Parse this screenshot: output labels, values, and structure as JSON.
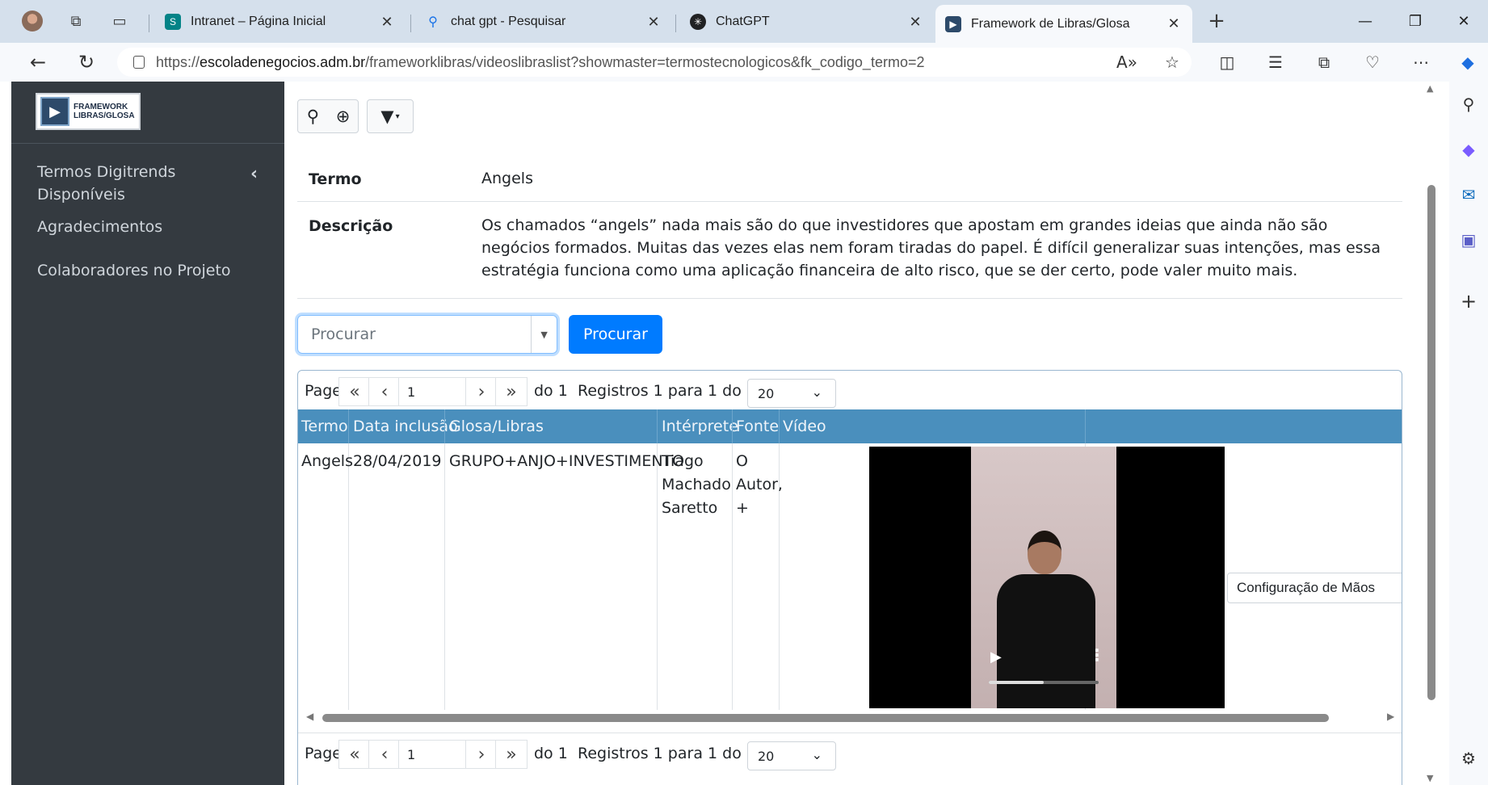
{
  "browser": {
    "tabs": [
      {
        "label": "Intranet – Página Inicial",
        "icon": "sharepoint-icon",
        "color": "#038387"
      },
      {
        "label": "chat gpt - Pesquisar",
        "icon": "search-icon",
        "color": "#1a73e8"
      },
      {
        "label": "ChatGPT",
        "icon": "openai-icon",
        "color": "#202123"
      },
      {
        "label": "Framework de Libras/Glosa",
        "icon": "framework-icon",
        "color": "#2d4a6a",
        "active": true
      }
    ],
    "url": {
      "prefix": "https://",
      "host": "escoladenegocios.adm.br",
      "path": "/frameworklibras/videoslibraslist?showmaster=termostecnologicos&fk_codigo_termo=2"
    }
  },
  "sidebar": {
    "logo": {
      "line1": "FRAMEWORK",
      "line2": "LIBRAS/GLOSA"
    },
    "items": [
      {
        "label": "Termos Digitrends Disponíveis"
      },
      {
        "label": "Agradecimentos"
      },
      {
        "label": "Colaboradores no Projeto"
      }
    ]
  },
  "master": {
    "termo_label": "Termo",
    "termo_value": "Angels",
    "descricao_label": "Descrição",
    "descricao_value": "Os chamados “angels” nada mais são do que investidores que apostam em grandes ideias que ainda não são negócios formados. Muitas das vezes elas nem foram tiradas do papel. É difícil generalizar suas intenções, mas essa estratégia funciona como uma aplicação financeira de alto risco, que se der certo, pode valer muito mais."
  },
  "search": {
    "placeholder": "Procurar",
    "button": "Procurar"
  },
  "pager": {
    "page_label": "Page",
    "first": "«",
    "prev": "‹",
    "next": "›",
    "last": "»",
    "current": "1",
    "of_text": "do 1",
    "records": "Registros 1 para 1 do 1",
    "page_size": "20"
  },
  "table": {
    "headers": [
      "Termo",
      "Data inclusão",
      "Glosa/Libras",
      "Intérprete",
      "Fonte",
      "Vídeo"
    ],
    "rows": [
      {
        "termo": "Angels",
        "data": "28/04/2019",
        "glosa": "GRUPO+ANJO+INVESTIMENTO",
        "interprete": [
          "Tiago",
          "Machado",
          "Saretto"
        ],
        "fonte": [
          "O",
          "Autor,",
          "+"
        ],
        "video_progress": 0.5,
        "action": "Configuração de Mãos"
      }
    ]
  },
  "colors": {
    "sidebar_bg": "#343a40",
    "table_header_bg": "#4a8fbd",
    "primary": "#007bff"
  }
}
